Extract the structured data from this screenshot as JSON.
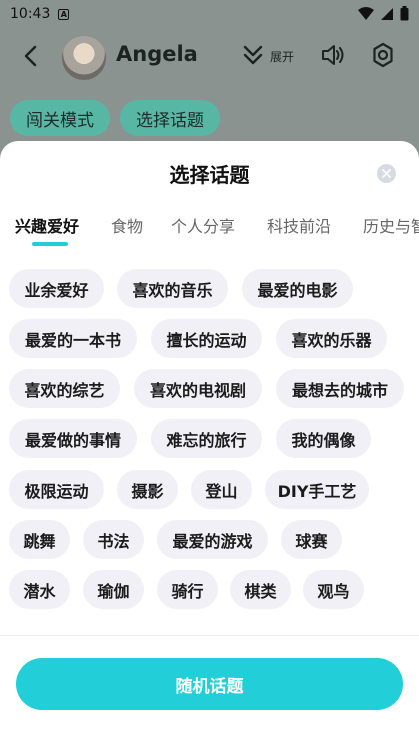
{
  "status_bar": {
    "time": "10:43",
    "app_icon_glyph": "A"
  },
  "header": {
    "name": "Angela",
    "expand_label": "展开"
  },
  "modes": [
    {
      "label": "闯关模式"
    },
    {
      "label": "选择话题"
    }
  ],
  "sheet": {
    "title": "选择话题",
    "tabs": [
      {
        "label": "兴趣爱好"
      },
      {
        "label": "食物"
      },
      {
        "label": "个人分享"
      },
      {
        "label": "科技前沿"
      },
      {
        "label": "历史与智"
      }
    ],
    "active_tab": "兴趣爱好",
    "topics": [
      "业余爱好",
      "喜欢的音乐",
      "最爱的电影",
      "最爱的一本书",
      "擅长的运动",
      "喜欢的乐器",
      "喜欢的综艺",
      "喜欢的电视剧",
      "最想去的城市",
      "最爱做的事情",
      "难忘的旅行",
      "我的偶像",
      "极限运动",
      "摄影",
      "登山",
      "DIY手工艺",
      "跳舞",
      "书法",
      "最爱的游戏",
      "球赛",
      "潜水",
      "瑜伽",
      "骑行",
      "棋类",
      "观鸟"
    ],
    "random_button": "随机话题"
  },
  "colors": {
    "accent": "#22cfd8",
    "chip_bg": "#f1f0f7",
    "overlay_bg": "#8a9390",
    "mode_chip": "#58b6a4"
  }
}
